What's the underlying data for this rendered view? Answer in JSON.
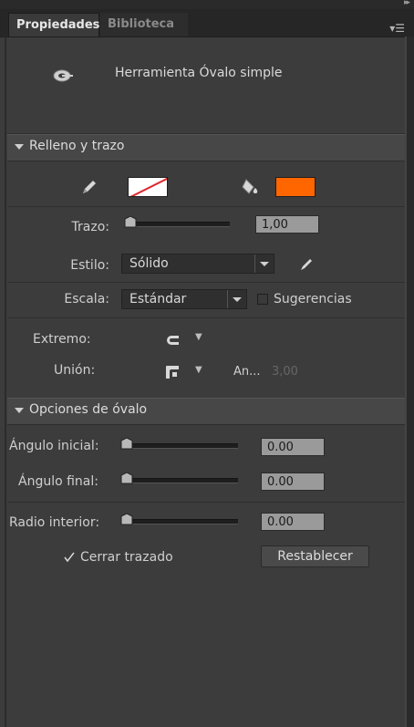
{
  "tabs": [
    {
      "label": "Propiedades",
      "active": true
    },
    {
      "label": "Biblioteca",
      "active": false
    }
  ],
  "tool": {
    "title": "Herramienta Óvalo simple",
    "icon": "oval-tool-icon"
  },
  "sections": {
    "fill_stroke": {
      "title": "Relleno y trazo",
      "stroke_color": "none",
      "fill_color": "#FF6600",
      "trazo": {
        "label": "Trazo:",
        "value": "1,00",
        "slider_fraction": 0.05
      },
      "estilo": {
        "label": "Estilo:",
        "value": "Sólido"
      },
      "escala": {
        "label": "Escala:",
        "value": "Estándar"
      },
      "sugerencias": {
        "label": "Sugerencias",
        "checked": false
      },
      "extremo": {
        "label": "Extremo:"
      },
      "union": {
        "label": "Unión:",
        "miter_label": "An...",
        "miter_value": "3,00"
      }
    },
    "oval_options": {
      "title": "Opciones de óvalo",
      "start_angle": {
        "label": "Ángulo inicial:",
        "value": "0.00",
        "slider_fraction": 0.0
      },
      "end_angle": {
        "label": "Ángulo final:",
        "value": "0.00",
        "slider_fraction": 0.0
      },
      "inner_radius": {
        "label": "Radio interior:",
        "value": "0.00",
        "slider_fraction": 0.0
      },
      "close_path": {
        "label": "Cerrar trazado",
        "checked": true
      },
      "reset_button": "Restablecer"
    }
  },
  "colors": {
    "panel_bg": "#3c3c3c",
    "fill_swatch": "#FF6600",
    "accent_none": "#e0262e"
  }
}
